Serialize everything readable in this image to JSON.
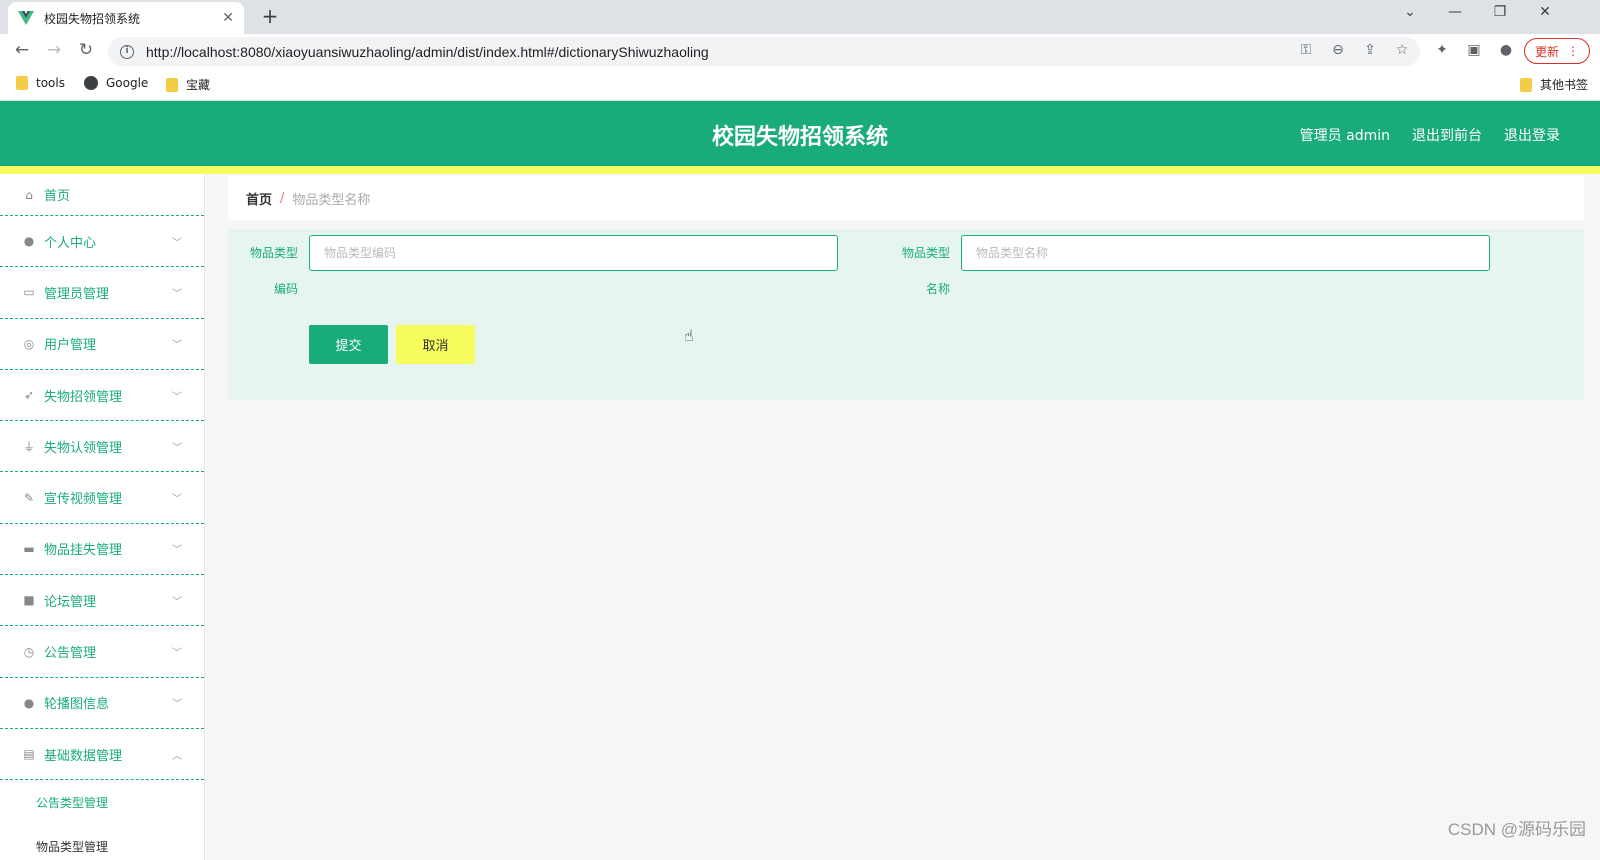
{
  "browser": {
    "tab_title": "校园失物招领系统",
    "url": "http://localhost:8080/xiaoyuansiwuzhaoling/admin/dist/index.html#/dictionaryShiwuzhaoling",
    "update_label": "更新",
    "bookmarks": [
      "tools",
      "Google",
      "宝藏"
    ],
    "other_bookmarks": "其他书签"
  },
  "header": {
    "title": "校园失物招领系统",
    "admin_label": "管理员 admin",
    "exit_front": "退出到前台",
    "logout": "退出登录"
  },
  "sidebar": {
    "items": [
      {
        "label": "首页",
        "icon": "home-icon"
      },
      {
        "label": "个人中心",
        "icon": "user-icon"
      },
      {
        "label": "管理员管理",
        "icon": "id-card-icon"
      },
      {
        "label": "用户管理",
        "icon": "circle-user-icon"
      },
      {
        "label": "失物招领管理",
        "icon": "send-icon"
      },
      {
        "label": "失物认领管理",
        "icon": "microphone-icon"
      },
      {
        "label": "宣传视频管理",
        "icon": "brush-icon"
      },
      {
        "label": "物品挂失管理",
        "icon": "briefcase-icon"
      },
      {
        "label": "论坛管理",
        "icon": "chat-icon"
      },
      {
        "label": "公告管理",
        "icon": "clock-icon"
      },
      {
        "label": "轮播图信息",
        "icon": "user-icon"
      },
      {
        "label": "基础数据管理",
        "icon": "clipboard-icon"
      }
    ],
    "sub_items": [
      "公告类型管理",
      "物品类型管理"
    ]
  },
  "breadcrumb": {
    "home": "首页",
    "sep": "/",
    "current": "物品类型名称"
  },
  "form": {
    "code_label_1": "物品类型",
    "code_label_2": "编码",
    "code_placeholder": "物品类型编码",
    "name_label_1": "物品类型",
    "name_label_2": "名称",
    "name_placeholder": "物品类型名称",
    "submit": "提交",
    "cancel": "取消"
  },
  "watermark": "CSDN @源码乐园",
  "colors": {
    "primary": "#1aab7c",
    "accent_yellow": "#f6fb5e",
    "panel_bg": "#e6f5ef"
  }
}
